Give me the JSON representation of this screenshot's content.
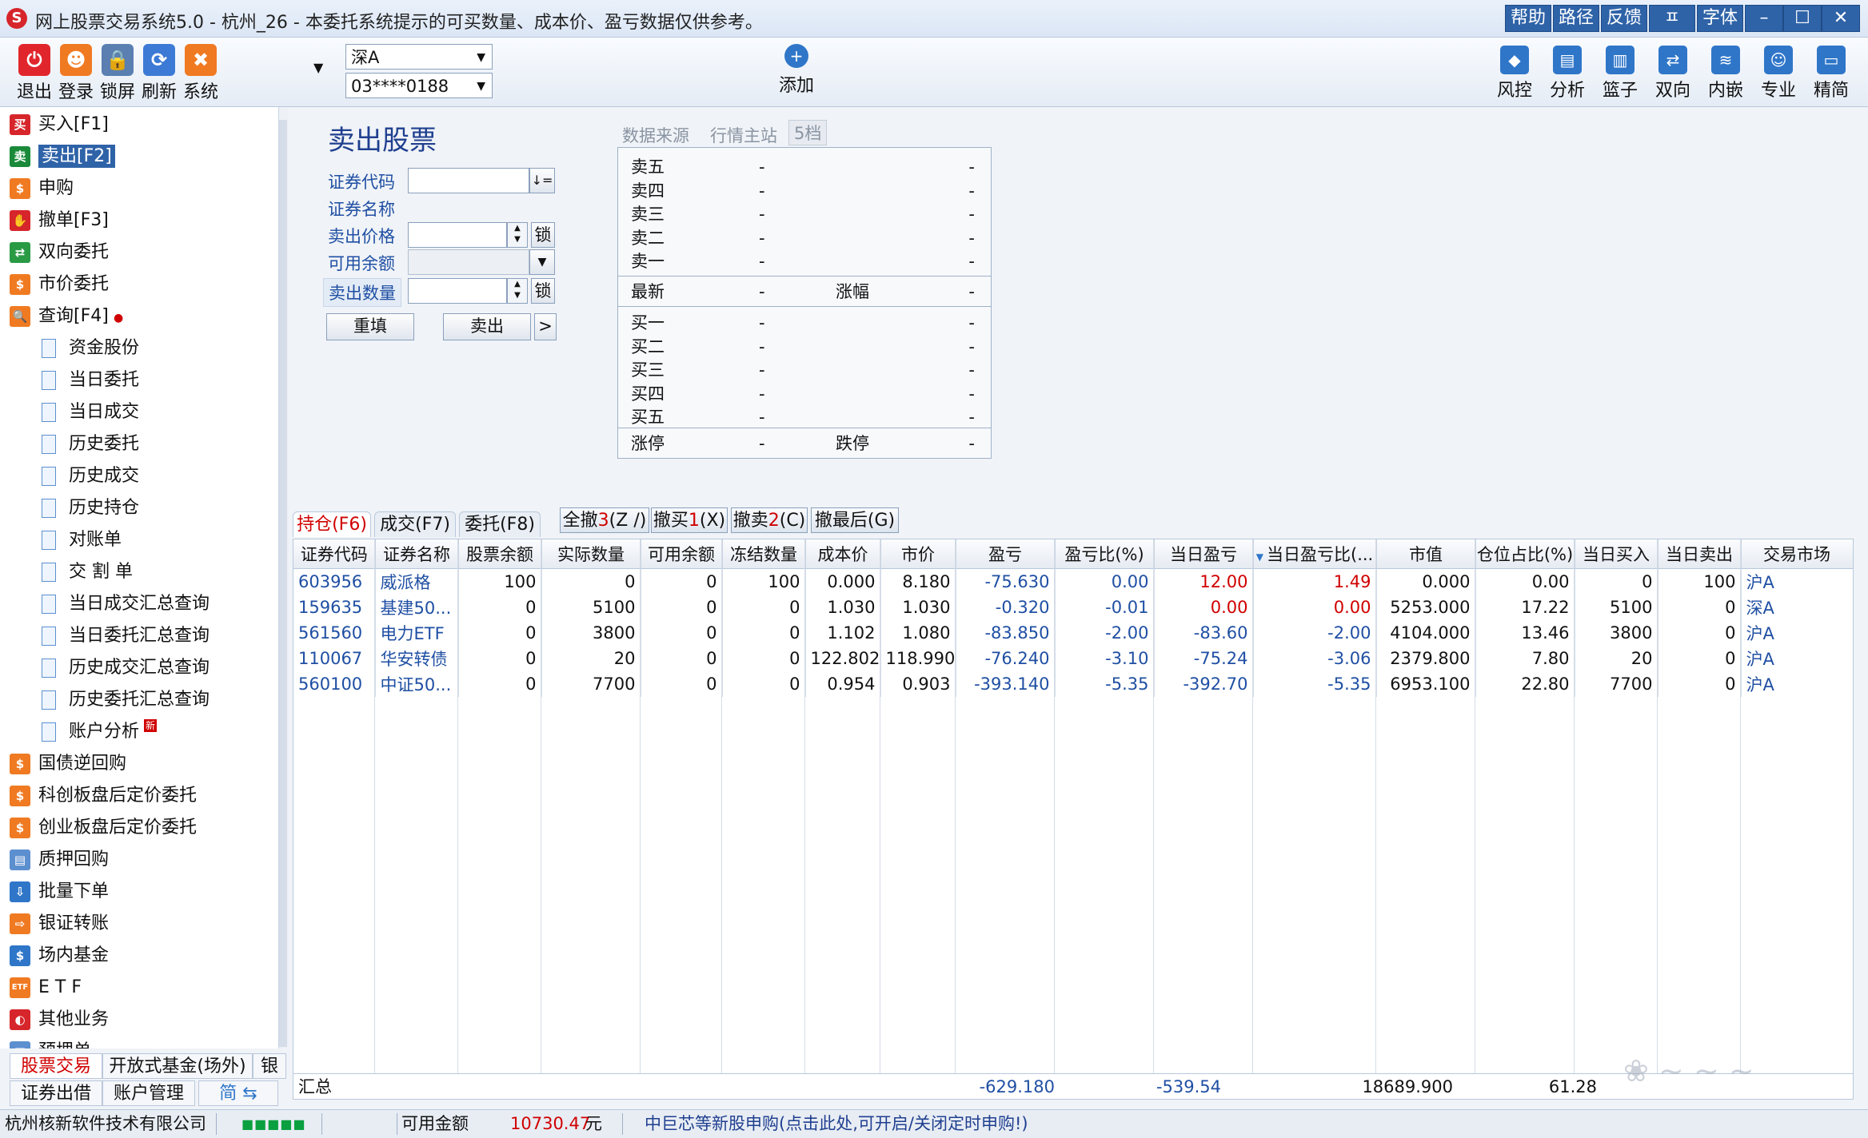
{
  "window": {
    "title": "网上股票交易系统5.0 - 杭州_26 - 本委托系统提示的可买数量、成本价、盈亏数据仅供参考。",
    "title_buttons": [
      "帮助",
      "路径",
      "反馈",
      "ㅍ",
      "字体"
    ],
    "controls": {
      "minimize": "–",
      "maximize": "☐",
      "close": "✕"
    }
  },
  "toolbar": {
    "left": [
      {
        "label": "退出",
        "icon": "power-icon",
        "color": "#e0262c",
        "glyph": "⏻"
      },
      {
        "label": "登录",
        "icon": "user-login-icon",
        "color": "#f07a22",
        "glyph": "☻"
      },
      {
        "label": "锁屏",
        "icon": "lock-icon",
        "color": "#5a7fb0",
        "glyph": "🔒"
      },
      {
        "label": "刷新",
        "icon": "refresh-icon",
        "color": "#3d7ad6",
        "glyph": "⟳"
      },
      {
        "label": "系统",
        "icon": "tools-icon",
        "color": "#f07a22",
        "glyph": "✖"
      }
    ],
    "market_select": "深A",
    "account_select": "03****0188",
    "add_label": "添加",
    "right": [
      {
        "label": "风控",
        "icon": "shield-icon",
        "color": "#2f76c9",
        "glyph": "◆"
      },
      {
        "label": "分析",
        "icon": "analysis-icon",
        "color": "#2f76c9",
        "glyph": "▤"
      },
      {
        "label": "篮子",
        "icon": "basket-icon",
        "color": "#2f76c9",
        "glyph": "▥"
      },
      {
        "label": "双向",
        "icon": "two-way-icon",
        "color": "#2f76c9",
        "glyph": "⇄"
      },
      {
        "label": "内嵌",
        "icon": "layers-icon",
        "color": "#2f76c9",
        "glyph": "≋"
      },
      {
        "label": "专业",
        "icon": "person-icon",
        "color": "#2f76c9",
        "glyph": "☺"
      },
      {
        "label": "精简",
        "icon": "chat-icon",
        "color": "#2f76c9",
        "glyph": "▭"
      }
    ]
  },
  "sidebar": {
    "items": [
      {
        "label": "买入[F1]",
        "icon": "buy-icon",
        "glyph": "买",
        "color": "#d6262b"
      },
      {
        "label": "卖出[F2]",
        "icon": "sell-icon",
        "glyph": "卖",
        "color": "#1a8a3a"
      },
      {
        "label": "申购",
        "icon": "subscribe-icon",
        "glyph": "$",
        "color": "#f07a22"
      },
      {
        "label": "撤单[F3]",
        "icon": "cancel-hand-icon",
        "glyph": "✋",
        "color": "#d6262b"
      },
      {
        "label": "双向委托",
        "icon": "two-way-order-icon",
        "glyph": "⇄",
        "color": "#2a9a45"
      },
      {
        "label": "市价委托",
        "icon": "market-order-icon",
        "glyph": "$",
        "color": "#f07a22"
      },
      {
        "label": "查询[F4]",
        "icon": "query-search-icon",
        "glyph": "🔍",
        "color": "#f07a22"
      }
    ],
    "sub_items": [
      "资金股份",
      "当日委托",
      "当日成交",
      "历史委托",
      "历史成交",
      "历史持仓",
      "对账单",
      "交 割 单",
      "当日成交汇总查询",
      "当日委托汇总查询",
      "历史成交汇总查询",
      "历史委托汇总查询",
      "账户分析"
    ],
    "new_badge": "新",
    "items2": [
      {
        "label": "国债逆回购",
        "icon": "bond-repo-icon",
        "glyph": "$",
        "color": "#f07a22"
      },
      {
        "label": "科创板盘后定价委托",
        "icon": "star-market-icon",
        "glyph": "$",
        "color": "#f07a22"
      },
      {
        "label": "创业板盘后定价委托",
        "icon": "gem-market-icon",
        "glyph": "$",
        "color": "#f07a22"
      },
      {
        "label": "质押回购",
        "icon": "pledge-icon",
        "glyph": "▤",
        "color": "#5c8fcf"
      },
      {
        "label": "批量下单",
        "icon": "batch-order-icon",
        "glyph": "⇩",
        "color": "#2f76c9"
      },
      {
        "label": "银证转账",
        "icon": "bank-transfer-icon",
        "glyph": "⇨",
        "color": "#f07a22"
      },
      {
        "label": "场内基金",
        "icon": "fund-icon",
        "glyph": "$",
        "color": "#2f76c9"
      },
      {
        "label": "E T F",
        "icon": "etf-icon",
        "glyph": "ETF",
        "color": "#f07a22"
      },
      {
        "label": "其他业务",
        "icon": "other-business-icon",
        "glyph": "◐",
        "color": "#d6262b"
      },
      {
        "label": "预埋单",
        "icon": "preorder-icon",
        "glyph": "▤",
        "color": "#5c8fcf"
      }
    ],
    "bottom_tabs_row1": [
      "股票交易",
      "开放式基金(场外)",
      "银河"
    ],
    "bottom_tabs_row2": [
      "证券出借",
      "账户管理",
      "简 ⇆"
    ]
  },
  "sell_form": {
    "title": "卖出股票",
    "code_label": "证券代码",
    "code_value": "",
    "name_label": "证券名称",
    "price_label": "卖出价格",
    "price_value": "",
    "lock_label": "锁",
    "available_label": "可用余额",
    "quantity_label": "卖出数量",
    "quantity_value": "",
    "reset_button": "重填",
    "sell_button": "卖出",
    "more_button": ">",
    "sort_glyph": "↓="
  },
  "quote": {
    "source_label": "数据来源",
    "source_value": "行情主站",
    "depth_label": "5档",
    "sell_rows": [
      [
        "卖五",
        "-",
        "-"
      ],
      [
        "卖四",
        "-",
        "-"
      ],
      [
        "卖三",
        "-",
        "-"
      ],
      [
        "卖二",
        "-",
        "-"
      ],
      [
        "卖一",
        "-",
        "-"
      ]
    ],
    "latest": {
      "label": "最新",
      "value": "-",
      "change_label": "涨幅",
      "change_value": "-"
    },
    "buy_rows": [
      [
        "买一",
        "-",
        "-"
      ],
      [
        "买二",
        "-",
        "-"
      ],
      [
        "买三",
        "-",
        "-"
      ],
      [
        "买四",
        "-",
        "-"
      ],
      [
        "买五",
        "-",
        "-"
      ]
    ],
    "limit": {
      "label": "涨停",
      "value": "-",
      "down_label": "跌停",
      "down_value": "-"
    }
  },
  "tabs": [
    {
      "label": "持仓(F6)",
      "active": true
    },
    {
      "label": "成交(F7)",
      "active": false
    },
    {
      "label": "委托(F8)",
      "active": false
    }
  ],
  "actions": [
    {
      "prefix": "全撤",
      "count": "3",
      "suffix": "(Z /)"
    },
    {
      "prefix": "撤买",
      "count": "1",
      "suffix": "(X)"
    },
    {
      "prefix": "撤卖",
      "count": "2",
      "suffix": "(C)"
    },
    {
      "prefix": "撤最后(G)",
      "count": "",
      "suffix": ""
    }
  ],
  "table": {
    "columns": [
      "证券代码",
      "证券名称",
      "股票余额",
      "实际数量",
      "可用余额",
      "冻结数量",
      "成本价",
      "市价",
      "盈亏",
      "盈亏比(%)",
      "当日盈亏",
      "当日盈亏比(...",
      "市值",
      "仓位占比(%)",
      "当日买入",
      "当日卖出",
      "交易市场"
    ],
    "sort_marker": "▼",
    "rows": [
      [
        "603956",
        "威派格",
        "100",
        "0",
        "0",
        "100",
        "0.000",
        "8.180",
        "-75.630",
        "0.00",
        "12.00",
        "1.49",
        "0.000",
        "0.00",
        "0",
        "100",
        "沪A"
      ],
      [
        "159635",
        "基建50...",
        "0",
        "5100",
        "0",
        "0",
        "1.030",
        "1.030",
        "-0.320",
        "-0.01",
        "0.00",
        "0.00",
        "5253.000",
        "17.22",
        "5100",
        "0",
        "深A"
      ],
      [
        "561560",
        "电力ETF",
        "0",
        "3800",
        "0",
        "0",
        "1.102",
        "1.080",
        "-83.850",
        "-2.00",
        "-83.60",
        "-2.00",
        "4104.000",
        "13.46",
        "3800",
        "0",
        "沪A"
      ],
      [
        "110067",
        "华安转债",
        "0",
        "20",
        "0",
        "0",
        "122.802",
        "118.990",
        "-76.240",
        "-3.10",
        "-75.24",
        "-3.06",
        "2379.800",
        "7.80",
        "20",
        "0",
        "沪A"
      ],
      [
        "560100",
        "中证50...",
        "0",
        "7700",
        "0",
        "0",
        "0.954",
        "0.903",
        "-393.140",
        "-5.35",
        "-392.70",
        "-5.35",
        "6953.100",
        "22.80",
        "7700",
        "0",
        "沪A"
      ]
    ],
    "summary": {
      "label": "汇总",
      "pnl": "-629.180",
      "today_pnl": "-539.54",
      "market_value": "18689.900",
      "position_ratio": "61.28"
    }
  },
  "status": {
    "company": "杭州核新软件技术有限公司",
    "signal": "■■■■■",
    "available_label": "可用金额",
    "available_value": "10730.47",
    "currency": "元",
    "ipo_notice": "中巨芯等新股申购(点击此处,可开启/关闭定时申购!)"
  }
}
